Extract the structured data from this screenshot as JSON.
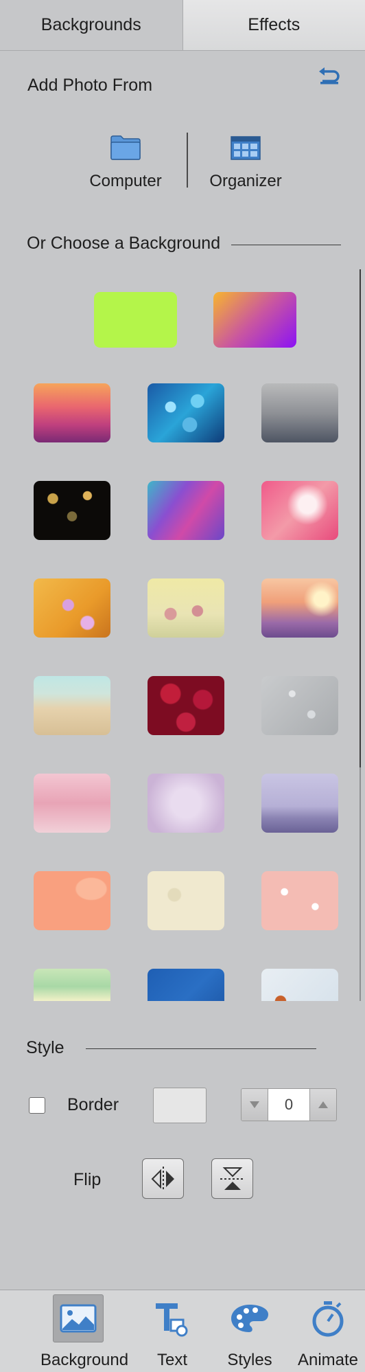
{
  "tabs": [
    {
      "label": "Backgrounds",
      "active": true
    },
    {
      "label": "Effects",
      "active": false
    }
  ],
  "add_photo": {
    "title": "Add Photo From",
    "sources": [
      {
        "label": "Computer",
        "icon": "folder-icon"
      },
      {
        "label": "Organizer",
        "icon": "organizer-grid-icon"
      }
    ]
  },
  "background_section": {
    "title": "Or Choose a Background",
    "solid_swatches": [
      {
        "name": "lime",
        "color": "#b4f54a"
      },
      {
        "name": "orange-purple-gradient",
        "colors": [
          "#f7b52e",
          "#8b12f5"
        ]
      }
    ],
    "thumbnails": [
      "pink-orange-waves",
      "blue-bokeh",
      "foggy-forest",
      "dark-bokeh-lights",
      "purple-polygon",
      "pink-watercolor",
      "orchid-flowers-yellow",
      "cosmos-flowers",
      "lavender-field-sunset",
      "starfish-beach",
      "red-roses",
      "water-droplets",
      "pink-glitter",
      "lilac-handwriting",
      "purple-pine-trees",
      "peach-leaves",
      "cream-seashells",
      "pink-floral-pattern",
      "green-leaves",
      "blue-airplanes",
      "autumn-leaves"
    ]
  },
  "style": {
    "title": "Style",
    "border_label": "Border",
    "border_checked": false,
    "border_value": "0",
    "flip_label": "Flip"
  },
  "bottom_bar": [
    {
      "label": "Background",
      "icon": "background-image-icon",
      "active": true
    },
    {
      "label": "Text",
      "icon": "text-tool-icon",
      "active": false
    },
    {
      "label": "Styles",
      "icon": "palette-icon",
      "active": false
    },
    {
      "label": "Animate",
      "icon": "stopwatch-icon",
      "active": false
    }
  ],
  "colors": {
    "panel_bg": "#c6c7c9",
    "accent_blue": "#3f7fc7",
    "text": "#1e1e1e"
  }
}
